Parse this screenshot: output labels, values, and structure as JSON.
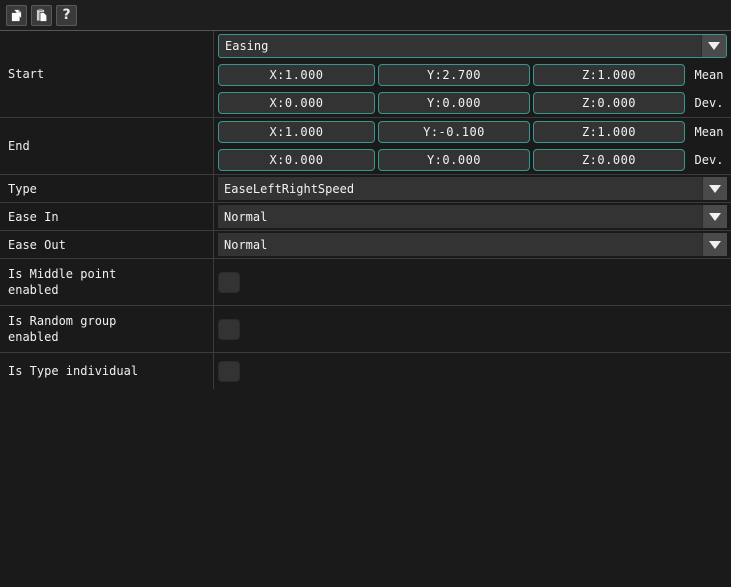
{
  "toolbar": {
    "buttons": [
      {
        "name": "copy-button",
        "icon": "copy-icon",
        "tooltip": "Copy"
      },
      {
        "name": "paste-button",
        "icon": "paste-icon",
        "tooltip": "Paste"
      },
      {
        "name": "help-button",
        "icon": "help-icon",
        "glyph": "?",
        "tooltip": "Help"
      }
    ]
  },
  "colors": {
    "background": "#1a1a1a",
    "accent": "#38968f",
    "field": "#333333",
    "divider": "#3c3c3c",
    "text": "#f0f0f0"
  },
  "category": {
    "label": "",
    "value": "Easing"
  },
  "start": {
    "label": "Start",
    "mean": {
      "x": "X:1.000",
      "y": "Y:2.700",
      "z": "Z:1.000",
      "suffix": "Mean"
    },
    "dev": {
      "x": "X:0.000",
      "y": "Y:0.000",
      "z": "Z:0.000",
      "suffix": "Dev."
    }
  },
  "end": {
    "label": "End",
    "mean": {
      "x": "X:1.000",
      "y": "Y:-0.100",
      "z": "Z:1.000",
      "suffix": "Mean"
    },
    "dev": {
      "x": "X:0.000",
      "y": "Y:0.000",
      "z": "Z:0.000",
      "suffix": "Dev."
    }
  },
  "type": {
    "label": "Type",
    "value": "EaseLeftRightSpeed"
  },
  "ease_in": {
    "label": "Ease In",
    "value": "Normal"
  },
  "ease_out": {
    "label": "Ease Out",
    "value": "Normal"
  },
  "middle_point": {
    "label_line1": "Is Middle point",
    "label_line2": "enabled",
    "checked": false
  },
  "random_group": {
    "label_line1": "Is Random group",
    "label_line2": "enabled",
    "checked": false
  },
  "type_individual": {
    "label_line1": "Is Type individual",
    "label_line2": "",
    "checked": false
  }
}
